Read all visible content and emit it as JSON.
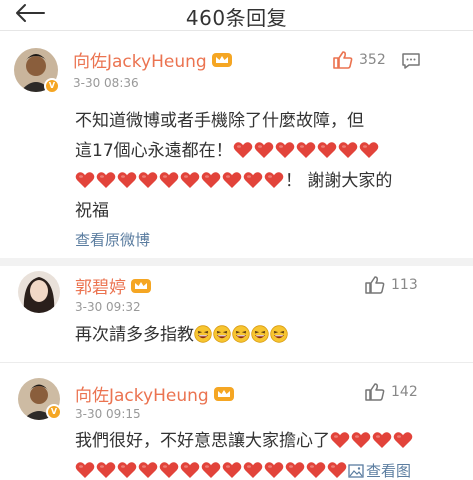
{
  "header": {
    "title": "460条回复"
  },
  "colors": {
    "name": "#eb7350",
    "link": "#5b7da0",
    "heart": "#e2433a",
    "crown": "#f5a623"
  },
  "comments": [
    {
      "name": "向佐JackyHeung",
      "time": "3-30 08:36",
      "likes": "352",
      "line1": "不知道微博或者手機除了什麼故障，但",
      "line2_text": "這17個心永遠都在！",
      "line2_hearts": 7,
      "line3_hearts": 10,
      "line3_text": "！ 謝謝大家的",
      "line4": "祝福",
      "view_original": "查看原微博"
    },
    {
      "name": "郭碧婷",
      "time": "3-30 09:32",
      "likes": "113",
      "text": "再次請多多指教",
      "emoji_count": 5
    },
    {
      "name": "向佐JackyHeung",
      "time": "3-30 09:15",
      "likes": "142",
      "line1": "我們很好，不好意思讓大家擔心了",
      "line1_hearts": 4,
      "line2_hearts": 13,
      "view_pic": "查看图"
    }
  ],
  "icons": {
    "back": "arrow-left-icon",
    "like": "thumbs-up-icon",
    "reply": "message-icon",
    "badge": "verified-v-icon",
    "crown": "crown-icon",
    "heart": "heart-emoji",
    "grin": "laughing-emoji",
    "pic": "image-icon"
  }
}
